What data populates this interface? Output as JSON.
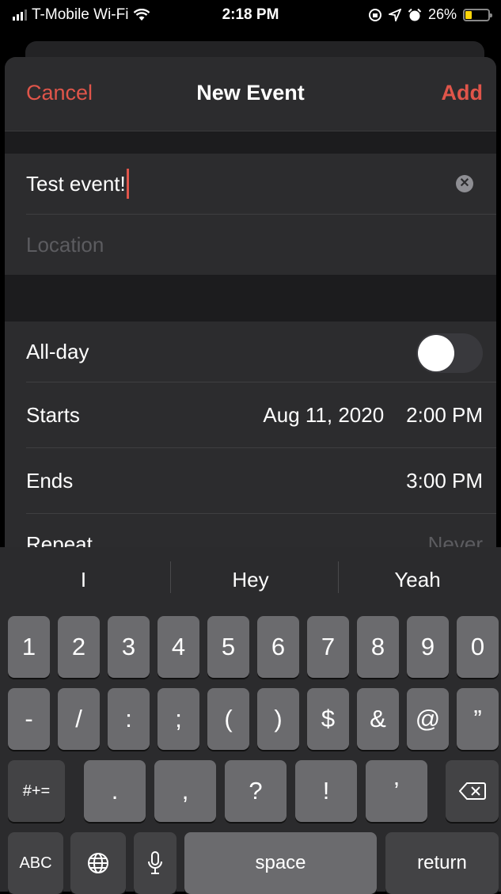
{
  "status_bar": {
    "carrier": "T-Mobile Wi-Fi",
    "time": "2:18 PM",
    "battery": "26%"
  },
  "nav": {
    "cancel": "Cancel",
    "title": "New Event",
    "add": "Add"
  },
  "title_field": {
    "value": "Test event!"
  },
  "location_field": {
    "placeholder": "Location"
  },
  "allday": {
    "label": "All-day",
    "on": false
  },
  "starts": {
    "label": "Starts",
    "date": "Aug 11, 2020",
    "time": "2:00 PM"
  },
  "ends": {
    "label": "Ends",
    "time": "3:00 PM"
  },
  "repeat": {
    "label": "Repeat",
    "value": "Never"
  },
  "suggestions": [
    "I",
    "Hey",
    "Yeah"
  ],
  "keyboard": {
    "row1": [
      "1",
      "2",
      "3",
      "4",
      "5",
      "6",
      "7",
      "8",
      "9",
      "0"
    ],
    "row2": [
      "-",
      "/",
      ":",
      ";",
      "(",
      ")",
      "$",
      "&",
      "@",
      "”"
    ],
    "row3": [
      "#+=",
      ".",
      ",",
      "?",
      "!",
      "’"
    ],
    "abc": "ABC",
    "space": "space",
    "return": "return"
  },
  "colors": {
    "accent": "#e0554a",
    "sheet": "#2c2c2e",
    "keyboard": "#2b2b2d"
  }
}
